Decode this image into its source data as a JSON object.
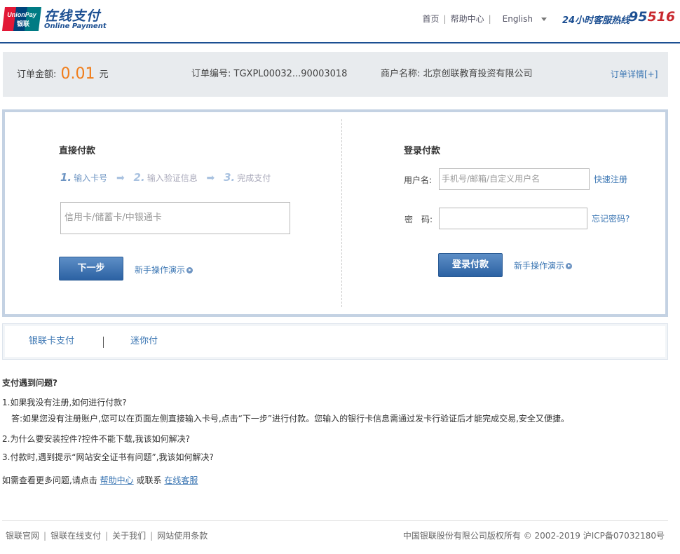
{
  "header": {
    "logo_badge_text": "UnionPay 银联",
    "brand_cn": "在线支付",
    "brand_en": "Online Payment",
    "nav": [
      "首页",
      "帮助中心"
    ],
    "language": "English",
    "hotline_label": "24小时客服热线",
    "hotline_number_part1": "95",
    "hotline_number_part2": "516"
  },
  "order": {
    "amount_label": "订单金额:",
    "amount_value": "0.01",
    "amount_unit": "元",
    "number_label": "订单编号:",
    "number_value": "TGXPL00032...90003018",
    "merchant_label": "商户名称:",
    "merchant_value": "北京创联教育投资有限公司",
    "detail_link": "订单详情[+]"
  },
  "direct_pay": {
    "title": "直接付款",
    "steps": [
      {
        "num": "1.",
        "label": "输入卡号"
      },
      {
        "num": "2.",
        "label": "输入验证信息"
      },
      {
        "num": "3.",
        "label": "完成支付"
      }
    ],
    "card_placeholder": "信用卡/储蓄卡/中银通卡",
    "next_button": "下一步",
    "demo_link": "新手操作演示"
  },
  "login_pay": {
    "title": "登录付款",
    "username_label": "用户名:",
    "username_placeholder": "手机号/邮箱/自定义用户名",
    "register_link": "快速注册",
    "password_label": "密　码:",
    "forgot_link": "忘记密码?",
    "login_button": "登录付款",
    "demo_link": "新手操作演示"
  },
  "tabs": [
    "银联卡支付",
    "迷你付"
  ],
  "faq": {
    "title": "支付遇到问题?",
    "q1": "1.如果我没有注册,如何进行付款?",
    "a1": "答:如果您没有注册账户,您可以在页面左侧直接输入卡号,点击“下一步”进行付款。您输入的银行卡信息需通过发卡行验证后才能完成交易,安全又便捷。",
    "q2": "2.为什么要安装控件?控件不能下载,我该如何解决?",
    "q3": "3.付款时,遇到提示“网站安全证书有问题”,我该如何解决?",
    "more_prefix": "如需查看更多问题,请点击",
    "help_link": "帮助中心",
    "more_mid": "或联系",
    "service_link": "在线客服"
  },
  "footer": {
    "links": [
      "银联官网",
      "银联在线支付",
      "关于我们",
      "网站使用条款"
    ],
    "copyright": "中国银联股份有限公司版权所有 © 2002-2019 沪ICP备07032180号"
  },
  "colors": {
    "brand_blue": "#1c4f92",
    "amount_orange": "#f07d1a",
    "link_blue": "#3b76b3",
    "hotline_red": "#c8282e"
  }
}
